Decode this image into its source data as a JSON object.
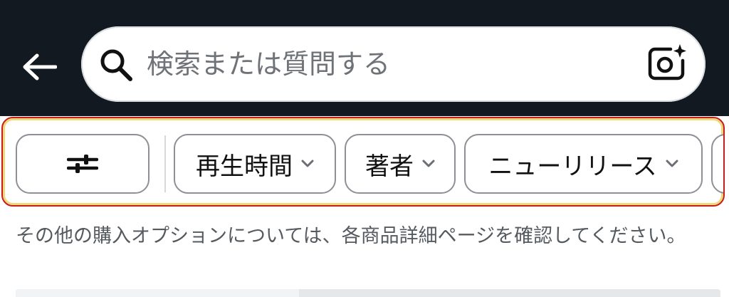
{
  "header": {
    "back_icon": "arrow-left-icon",
    "search": {
      "placeholder": "検索または質問する",
      "value": "",
      "search_icon": "magnifier-icon",
      "camera_icon": "camera-sparkle-icon"
    }
  },
  "filters": {
    "settings_icon": "sliders-icon",
    "chips": [
      {
        "label": "再生時間",
        "icon": "chevron-down-icon"
      },
      {
        "label": "著者",
        "icon": "chevron-down-icon"
      },
      {
        "label": "ニューリリース",
        "icon": "chevron-down-icon"
      }
    ],
    "highlight_color": "#c81d1d"
  },
  "notice": {
    "text": "その他の購入オプションについては、各商品詳細ページを確認してください。"
  },
  "colors": {
    "header_bg": "#131921",
    "chip_border": "#8d9095"
  }
}
